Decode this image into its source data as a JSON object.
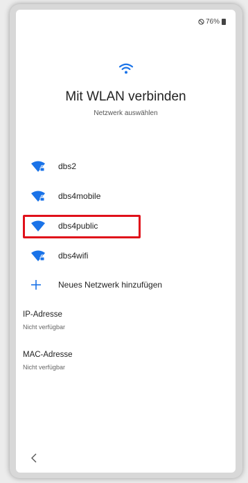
{
  "status_bar": {
    "battery": "76%",
    "icon": "do-not-disturb-icon"
  },
  "header": {
    "icon": "wifi-icon",
    "title": "Mit WLAN verbinden",
    "subtitle": "Netzwerk auswählen"
  },
  "networks": [
    {
      "name": "dbs2",
      "secured": true
    },
    {
      "name": "dbs4mobile",
      "secured": true
    },
    {
      "name": "dbs4public",
      "secured": false,
      "highlighted": true
    },
    {
      "name": "dbs4wifi",
      "secured": true
    }
  ],
  "add_network": {
    "label": "Neues Netzwerk hinzufügen",
    "icon": "plus-icon"
  },
  "ip": {
    "label": "IP-Adresse",
    "value": "Nicht verfügbar"
  },
  "mac": {
    "label": "MAC-Adresse",
    "value": "Nicht verfügbar"
  },
  "nav": {
    "back_icon": "chevron-left-icon"
  },
  "colors": {
    "accent": "#1a73e8",
    "highlight": "#e0101a"
  }
}
